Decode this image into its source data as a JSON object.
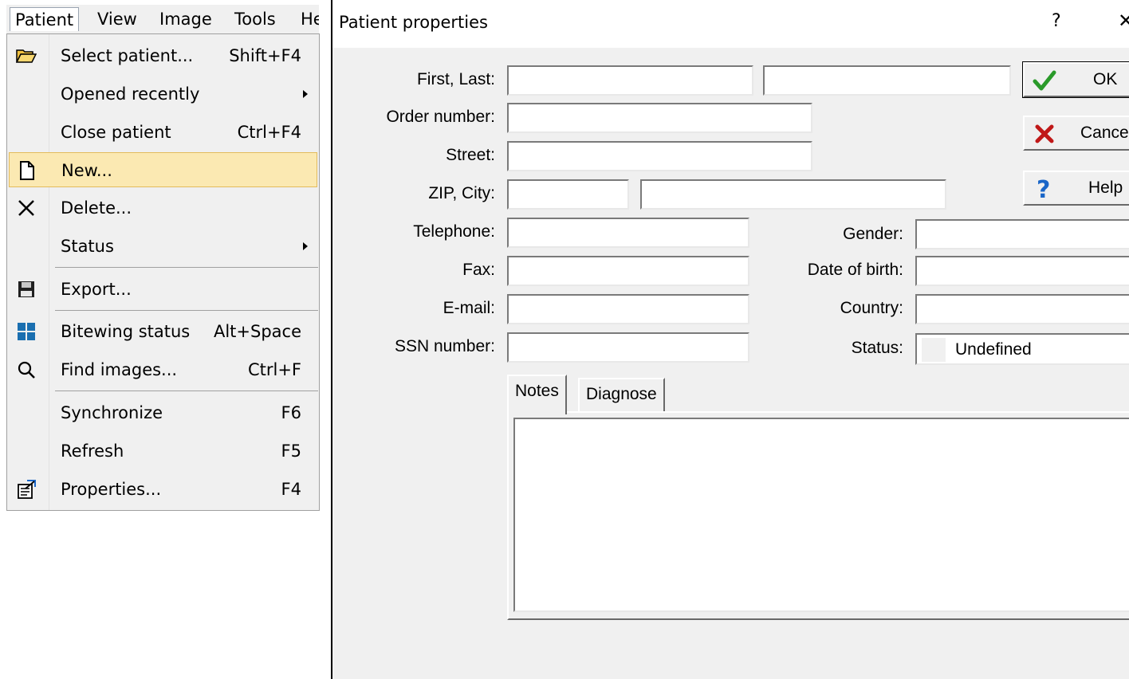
{
  "menubar": {
    "items": [
      {
        "label": "Patient",
        "active": true
      },
      {
        "label": "View"
      },
      {
        "label": "Image"
      },
      {
        "label": "Tools"
      },
      {
        "label": "He"
      }
    ]
  },
  "menu": {
    "items": [
      {
        "label": "Select patient...",
        "shortcut": "Shift+F4",
        "icon": "open-folder-icon"
      },
      {
        "label": "Opened recently",
        "shortcut": "",
        "submenu": true
      },
      {
        "label": "Close patient",
        "shortcut": "Ctrl+F4"
      },
      {
        "label": "New...",
        "shortcut": "",
        "icon": "new-document-icon",
        "highlighted": true
      },
      {
        "label": "Delete...",
        "shortcut": "",
        "icon": "delete-x-icon"
      },
      {
        "label": "Status",
        "shortcut": "",
        "submenu": true
      },
      {
        "label": "Export...",
        "shortcut": "",
        "icon": "save-disk-icon"
      },
      {
        "label": "Bitewing status",
        "shortcut": "Alt+Space",
        "icon": "grid-icon"
      },
      {
        "label": "Find images...",
        "shortcut": "Ctrl+F",
        "icon": "magnifier-icon"
      },
      {
        "label": "Synchronize",
        "shortcut": "F6"
      },
      {
        "label": "Refresh",
        "shortcut": "F5"
      },
      {
        "label": "Properties...",
        "shortcut": "F4",
        "icon": "properties-icon"
      }
    ]
  },
  "dialog": {
    "title": "Patient properties",
    "help_glyph": "?",
    "close_glyph": "✕",
    "labels": {
      "first_last": "First, Last:",
      "order_number": "Order number:",
      "street": "Street:",
      "zip_city": "ZIP, City:",
      "telephone": "Telephone:",
      "fax": "Fax:",
      "email": "E-mail:",
      "ssn": "SSN number:",
      "gender": "Gender:",
      "dob": "Date of birth:",
      "country": "Country:",
      "status": "Status:"
    },
    "values": {
      "first": "",
      "last": "",
      "order_number": "",
      "street": "",
      "zip": "",
      "city": "",
      "telephone": "",
      "fax": "",
      "email": "",
      "ssn": "",
      "gender": "",
      "dob": "",
      "country": ""
    },
    "status_value": "Undefined",
    "buttons": {
      "ok": "OK",
      "cancel": "Cance",
      "help": "Help"
    },
    "tabs": [
      "Notes",
      "Diagnose"
    ],
    "notes_text": "",
    "colors": {
      "menu_highlight": "#fbe9b2",
      "ok_check": "#2a9a2a",
      "cancel_x": "#c01818",
      "help_q": "#1a66c8"
    }
  }
}
